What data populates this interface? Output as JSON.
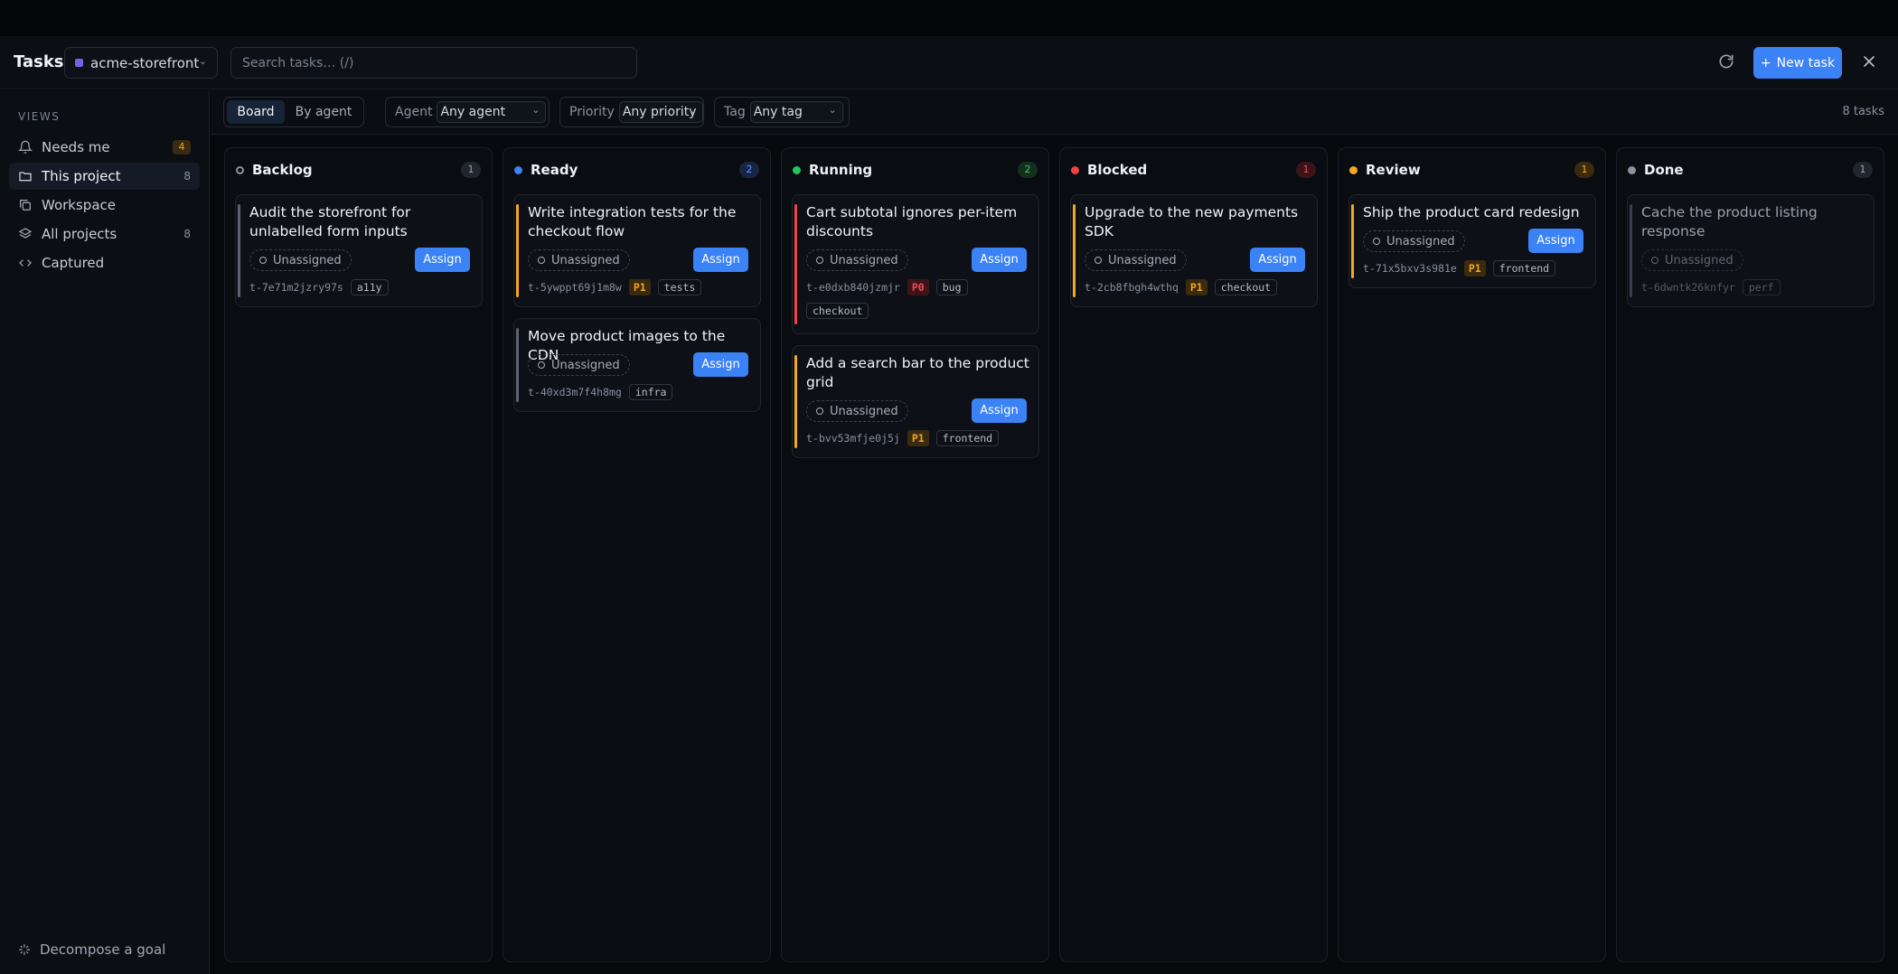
{
  "header": {
    "title": "Tasks",
    "project": "acme-storefront",
    "search_placeholder": "Search tasks… (/)",
    "new_task_label": "New task",
    "new_task_plus": "+"
  },
  "sidebar": {
    "views_label": "VIEWS",
    "items": [
      {
        "label": "Needs me",
        "badge": "4",
        "icon": "bell-icon"
      },
      {
        "label": "This project",
        "count": "8",
        "icon": "folder-icon",
        "active": true
      },
      {
        "label": "Workspace",
        "icon": "copy-icon"
      },
      {
        "label": "All projects",
        "count": "8",
        "icon": "layers-icon"
      },
      {
        "label": "Captured",
        "icon": "code-icon"
      }
    ],
    "decompose_label": "Decompose a goal"
  },
  "toolbar": {
    "view_board": "Board",
    "view_by_agent": "By agent",
    "agent_label": "Agent",
    "agent_value": "Any agent",
    "priority_label": "Priority",
    "priority_value": "Any priority",
    "tag_label": "Tag",
    "tag_value": "Any tag",
    "tasks_count": "8 tasks"
  },
  "columns": [
    {
      "title": "Backlog",
      "count": "1",
      "dot_color": "#0b0e13",
      "dot_border": "#8b93a1",
      "count_bg": "#20252e",
      "count_color": "#9aa1ad",
      "cards": [
        {
          "title": "Audit the storefront for unlabelled form inputs",
          "id": "t-7e71m2jzry97s",
          "tags": [
            "a11y"
          ],
          "bar": "#5d6470",
          "unassigned": "Unassigned",
          "assign": "Assign"
        }
      ]
    },
    {
      "title": "Ready",
      "count": "2",
      "dot_color": "#3b82f6",
      "count_bg": "#162544",
      "count_color": "#5b9cf8",
      "cards": [
        {
          "title": "Write integration tests for the checkout flow",
          "id": "t-5ywppt69j1m8w",
          "priority": "P1",
          "tags": [
            "tests"
          ],
          "bar": "#f5a623",
          "unassigned": "Unassigned",
          "assign": "Assign"
        },
        {
          "title": "Move product images to the CDN",
          "id": "t-40xd3m7f4h8mg",
          "tags": [
            "infra"
          ],
          "bar": "#5d6470",
          "unassigned": "Unassigned",
          "assign": "Assign"
        }
      ]
    },
    {
      "title": "Running",
      "count": "2",
      "dot_color": "#22c55e",
      "count_bg": "#12301d",
      "count_color": "#3ccb6b",
      "cards": [
        {
          "title": "Cart subtotal ignores per-item discounts",
          "id": "t-e0dxb840jzmjr",
          "priority": "P0",
          "tags": [
            "bug",
            "checkout"
          ],
          "bar": "#ef4444",
          "unassigned": "Unassigned",
          "assign": "Assign"
        },
        {
          "title": "Add a search bar to the product grid",
          "id": "t-bvv53mfje0j5j",
          "priority": "P1",
          "tags": [
            "frontend"
          ],
          "bar": "#f5a623",
          "unassigned": "Unassigned",
          "assign": "Assign"
        }
      ]
    },
    {
      "title": "Blocked",
      "count": "1",
      "dot_color": "#ef4444",
      "count_bg": "#3a1418",
      "count_color": "#f04b58",
      "cards": [
        {
          "title": "Upgrade to the new payments SDK",
          "id": "t-2cb8fbgh4wthq",
          "priority": "P1",
          "tags": [
            "checkout"
          ],
          "bar": "#f5a623",
          "unassigned": "Unassigned",
          "assign": "Assign"
        }
      ]
    },
    {
      "title": "Review",
      "count": "1",
      "dot_color": "#f5a623",
      "count_bg": "#3a2a0e",
      "count_color": "#f5a623",
      "cards": [
        {
          "title": "Ship the product card redesign",
          "id": "t-71x5bxv3s981e",
          "priority": "P1",
          "tags": [
            "frontend"
          ],
          "bar": "#f5a623",
          "unassigned": "Unassigned",
          "assign": "Assign"
        }
      ]
    },
    {
      "title": "Done",
      "count": "1",
      "dot_color": "#8b93a1",
      "count_bg": "#20252e",
      "count_color": "#9aa1ad",
      "cards": [
        {
          "title": "Cache the product listing response",
          "id": "t-6dwntk26knfyr",
          "tags": [
            "perf"
          ],
          "bar": "#3a404b",
          "unassigned": "Unassigned",
          "done": true
        }
      ]
    }
  ]
}
